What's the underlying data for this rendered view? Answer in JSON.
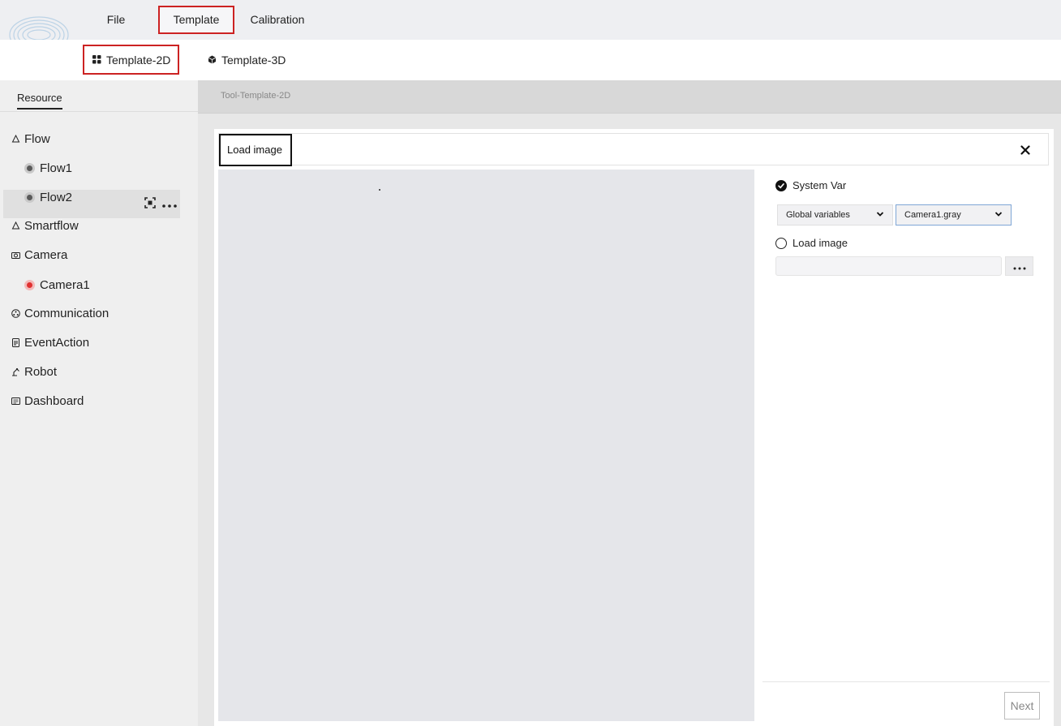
{
  "menu": {
    "file": "File",
    "template": "Template",
    "calibration": "Calibration"
  },
  "submenu": {
    "template_2d": "Template-2D",
    "template_3d": "Template-3D"
  },
  "sidebar": {
    "tab": "Resource",
    "items": [
      {
        "label": "Flow",
        "icon": "bell-icon"
      },
      {
        "label": "Flow1",
        "icon": "status-dot-gray"
      },
      {
        "label": "Flow2",
        "icon": "status-dot-gray"
      },
      {
        "label": "Smartflow",
        "icon": "bell-icon"
      },
      {
        "label": "Camera",
        "icon": "camera-icon"
      },
      {
        "label": "Camera1",
        "icon": "status-dot-red"
      },
      {
        "label": "Communication",
        "icon": "network-icon"
      },
      {
        "label": "EventAction",
        "icon": "document-icon"
      },
      {
        "label": "Robot",
        "icon": "robot-arm-icon"
      },
      {
        "label": "Dashboard",
        "icon": "dashboard-icon"
      }
    ]
  },
  "breadcrumb": "Tool-Template-2D",
  "dialog": {
    "title": "Load image",
    "system_var_label": "System Var",
    "scope_select": "Global variables",
    "variable_select": "Camera1.gray",
    "load_image_label": "Load image",
    "path_value": "",
    "next_label": "Next"
  },
  "colors": {
    "highlight_border": "#cc2222",
    "status_red": "#e03030",
    "status_gray": "#5a5a5a"
  }
}
